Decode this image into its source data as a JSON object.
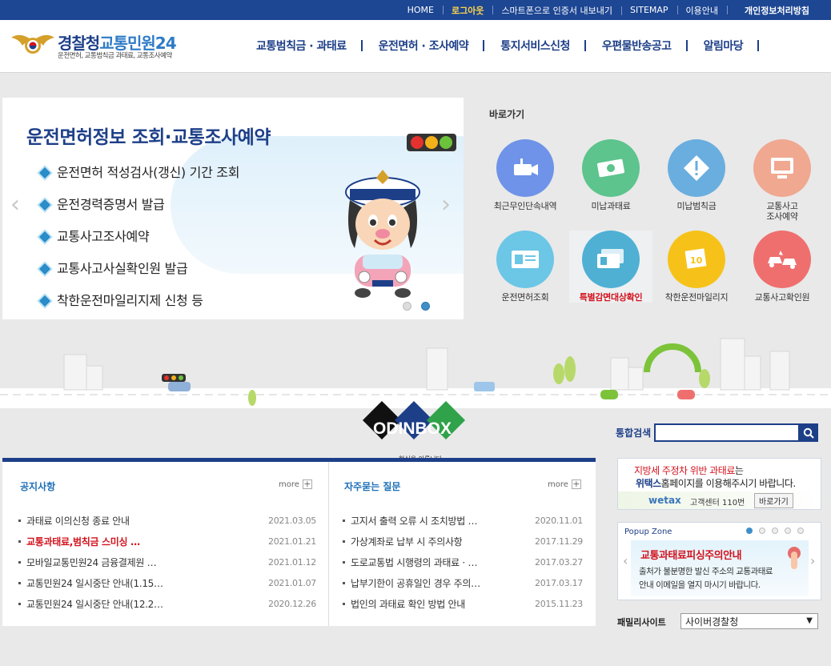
{
  "top_links": [
    "HOME",
    "로그아웃",
    "스마트폰으로 인증서 내보내기",
    "SITEMAP",
    "이용안내",
    "개인정보처리방침"
  ],
  "logo": {
    "title_a": "경찰청",
    "title_b": "교통민원24",
    "subtitle": "운전면허, 교통범칙금 과태료, 교통조사예약"
  },
  "gnb": [
    "교통범칙금 · 과태료",
    "운전면허 · 조사예약",
    "통지서비스신청",
    "우편물반송공고",
    "알림마당"
  ],
  "slider": {
    "title": "운전면허정보 조회·교통조사예약",
    "items": [
      "운전면허 적성검사(갱신) 기간 조회",
      "운전경력증명서 발급",
      "교통사고조사예약",
      "교통사고사실확인원 발급",
      "착한운전마일리지제 신청 등"
    ],
    "prev": "‹",
    "next": "›"
  },
  "quick": {
    "title": "바로가기",
    "items": [
      {
        "label": "최근무인단속내역",
        "color": "#6e93e8",
        "icon": "camera-icon"
      },
      {
        "label": "미납과태료",
        "color": "#5cc48c",
        "icon": "money-icon"
      },
      {
        "label": "미납범칙금",
        "color": "#6aaee0",
        "icon": "warning-icon"
      },
      {
        "label": "교통사고\n조사예약",
        "color": "#f0a890",
        "icon": "monitor-icon"
      },
      {
        "label": "운전면허조회",
        "color": "#6cc6e6",
        "icon": "license-card-icon"
      },
      {
        "label": "특별감면대상확인",
        "color": "#4fb0d4",
        "icon": "id-card-icon"
      },
      {
        "label": "착한운전마일리지",
        "color": "#f6c21a",
        "icon": "mileage-icon"
      },
      {
        "label": "교통사고확인원",
        "color": "#ef6f6f",
        "icon": "car-crash-icon"
      }
    ]
  },
  "odinbox": {
    "brand": "ODINBOX",
    "slogan": "혁신을 이룹니다"
  },
  "notice": {
    "title": "공지사항",
    "more": "more",
    "items": [
      {
        "title": "과태료 이의신청 종료 안내",
        "date": "2021.03.05"
      },
      {
        "title": "교통과태료,범칙금 스미싱 …",
        "date": "2021.01.21"
      },
      {
        "title": "모바일교통민원24 금융결제원 …",
        "date": "2021.01.12"
      },
      {
        "title": "교통민원24 일시중단 안내(1.15…",
        "date": "2021.01.07"
      },
      {
        "title": "교통민원24 일시중단 안내(12.2…",
        "date": "2020.12.26"
      }
    ]
  },
  "faq": {
    "title": "자주묻는 질문",
    "more": "more",
    "items": [
      {
        "title": "고지서 출력 오류 시 조치방법 …",
        "date": "2020.11.01"
      },
      {
        "title": "가상계좌로 납부 시 주의사항",
        "date": "2017.11.29"
      },
      {
        "title": "도로교통법 시행령의 과태료 · …",
        "date": "2017.03.27"
      },
      {
        "title": "납부기한이 공휴일인 경우 주의…",
        "date": "2017.03.17"
      },
      {
        "title": "법인의 과태료 확인 방법 안내",
        "date": "2015.11.23"
      }
    ]
  },
  "search": {
    "label": "통합검색",
    "value": ""
  },
  "wetax_banner": {
    "line1_red": "지방세 주정차 위반 과태료",
    "line1_rest": "는",
    "line2_bold": "위택스",
    "line2_rest": "홈페이지를 이용해주시기 바랍니다.",
    "brand": "wetax",
    "center": "고객센터 110번",
    "go": "바로가기"
  },
  "popup": {
    "zone_label": "Popup Zone",
    "title": "교통과태료피싱주의안내",
    "line1": "출처가 불분명한 발신 주소의 교통과태료",
    "line2": "안내 이메일을 열지 마시기 바랍니다."
  },
  "family": {
    "label": "패밀리사이트",
    "selected": "사이버경찰청"
  },
  "colors": {
    "navy": "#1d3f88",
    "accent_red": "#d3131d",
    "topbar": "#1d4693"
  }
}
